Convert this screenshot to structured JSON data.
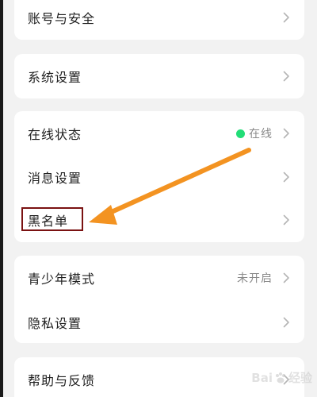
{
  "colors": {
    "background": "#f2f2f2",
    "card": "#ffffff",
    "online_dot": "#22dd77",
    "arrow": "#f39321",
    "highlight_border": "#7a1212"
  },
  "card_account": {
    "rows": [
      {
        "label": "账号与安全",
        "icon": "chevron-right-icon"
      }
    ]
  },
  "card_system": {
    "rows": [
      {
        "label": "系统设置",
        "icon": "chevron-right-icon"
      }
    ]
  },
  "card_status": {
    "rows": [
      {
        "label": "在线状态",
        "value": "在线",
        "icon": "chevron-right-icon"
      },
      {
        "label": "消息设置",
        "icon": "chevron-right-icon"
      },
      {
        "label": "黑名单",
        "icon": "chevron-right-icon"
      }
    ]
  },
  "card_privacy": {
    "rows": [
      {
        "label": "青少年模式",
        "value": "未开启",
        "icon": "chevron-right-icon"
      },
      {
        "label": "隐私设置",
        "icon": "chevron-right-icon"
      }
    ]
  },
  "card_help": {
    "rows": [
      {
        "label": "帮助与反馈",
        "icon": "chevron-right-icon"
      }
    ]
  },
  "annotation": {
    "arrow_icon": "orange-arrow-icon",
    "highlight": "blacklist-highlight-box"
  },
  "watermark": {
    "text_left": "Bai",
    "text_right": "经验",
    "icon": "baidu-paw-icon"
  }
}
